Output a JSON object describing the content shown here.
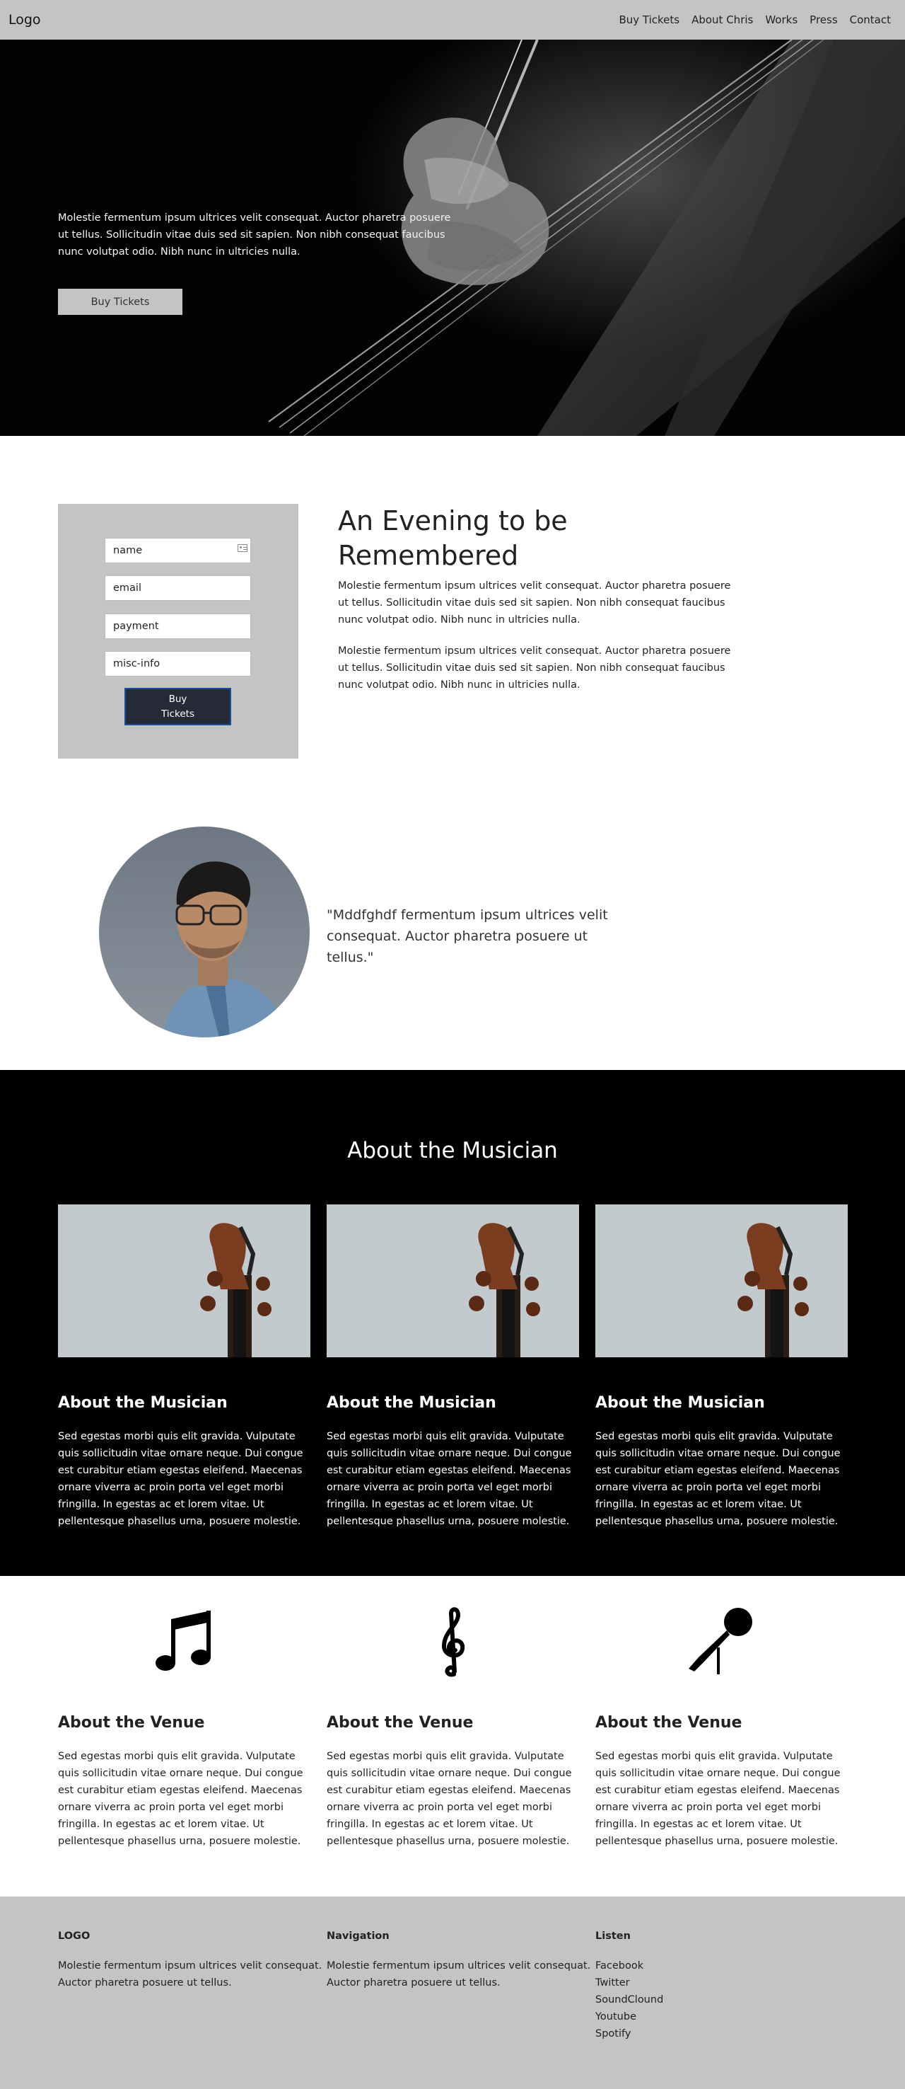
{
  "header": {
    "logo": "Logo",
    "nav": [
      "Buy Tickets",
      "About Chris",
      "Works",
      "Press",
      "Contact"
    ]
  },
  "hero": {
    "text": "Molestie fermentum ipsum ultrices velit consequat. Auctor pharetra posuere ut tellus. Sollicitudin vitae duis sed sit sapien. Non nibh consequat faucibus nunc volutpat odio. Nibh nunc in ultricies nulla.",
    "button": "Buy Tickets"
  },
  "form": {
    "name_placeholder": "name",
    "email_placeholder": "email",
    "payment_placeholder": "payment",
    "misc_placeholder": "misc-info",
    "button_line1": "Buy",
    "button_line2": "Tickets"
  },
  "evening": {
    "title": "An Evening to be Remembered",
    "paragraphs": [
      "Molestie fermentum ipsum ultrices velit consequat. Auctor pharetra posuere ut tellus. Sollicitudin vitae duis sed sit sapien. Non nibh consequat faucibus nunc volutpat odio. Nibh nunc in ultricies nulla.",
      "Molestie fermentum ipsum ultrices velit consequat. Auctor pharetra posuere ut tellus. Sollicitudin vitae duis sed sit sapien. Non nibh consequat faucibus nunc volutpat odio. Nibh nunc in ultricies nulla."
    ]
  },
  "quote": {
    "text": "\"Mddfghdf fermentum ipsum ultrices velit consequat. Auctor pharetra posuere ut tellus.\""
  },
  "about": {
    "title": "About the Musician",
    "cards": [
      {
        "heading": "About the Musician",
        "text": "Sed egestas morbi quis elit gravida. Vulputate quis sollicitudin vitae ornare neque. Dui congue est curabitur etiam egestas eleifend. Maecenas ornare viverra ac proin porta vel eget morbi fringilla. In egestas ac et lorem vitae. Ut pellentesque phasellus urna, posuere molestie."
      },
      {
        "heading": "About the Musician",
        "text": "Sed egestas morbi quis elit gravida. Vulputate quis sollicitudin vitae ornare neque. Dui congue est curabitur etiam egestas eleifend. Maecenas ornare viverra ac proin porta vel eget morbi fringilla. In egestas ac et lorem vitae. Ut pellentesque phasellus urna, posuere molestie."
      },
      {
        "heading": "About the Musician",
        "text": "Sed egestas morbi quis elit gravida. Vulputate quis sollicitudin vitae ornare neque. Dui congue est curabitur etiam egestas eleifend. Maecenas ornare viverra ac proin porta vel eget morbi fringilla. In egestas ac et lorem vitae. Ut pellentesque phasellus urna, posuere molestie."
      }
    ]
  },
  "venue": {
    "cards": [
      {
        "icon": "music-notes-icon",
        "heading": "About the Venue",
        "text": "Sed egestas morbi quis elit gravida. Vulputate quis sollicitudin vitae ornare neque. Dui congue est curabitur etiam egestas eleifend. Maecenas ornare viverra ac proin porta vel eget morbi fringilla. In egestas ac et lorem vitae. Ut pellentesque phasellus urna, posuere molestie."
      },
      {
        "icon": "treble-clef-icon",
        "heading": "About the Venue",
        "text": "Sed egestas morbi quis elit gravida. Vulputate quis sollicitudin vitae ornare neque. Dui congue est curabitur etiam egestas eleifend. Maecenas ornare viverra ac proin porta vel eget morbi fringilla. In egestas ac et lorem vitae. Ut pellentesque phasellus urna, posuere molestie."
      },
      {
        "icon": "microphone-icon",
        "heading": "About the Venue",
        "text": "Sed egestas morbi quis elit gravida. Vulputate quis sollicitudin vitae ornare neque. Dui congue est curabitur etiam egestas eleifend. Maecenas ornare viverra ac proin porta vel eget morbi fringilla. In egestas ac et lorem vitae. Ut pellentesque phasellus urna, posuere molestie."
      }
    ]
  },
  "footer": {
    "logo_heading": "LOGO",
    "logo_text": "Molestie fermentum ipsum ultrices velit consequat. Auctor pharetra posuere ut tellus.",
    "nav_heading": "Navigation",
    "nav_text": "Molestie fermentum ipsum ultrices velit consequat. Auctor pharetra posuere ut tellus.",
    "listen_heading": "Listen",
    "listen_links": [
      "Facebook",
      "Twitter",
      "SoundClound",
      "Youtube",
      "Spotify"
    ]
  },
  "colors": {
    "header_bg": "#c4c4c4",
    "hero_bg": "#030303",
    "about_bg": "#000000",
    "footer_bg": "#c4c4c4",
    "form_button_bg": "#252a36",
    "form_button_border": "#1d4fa0"
  }
}
